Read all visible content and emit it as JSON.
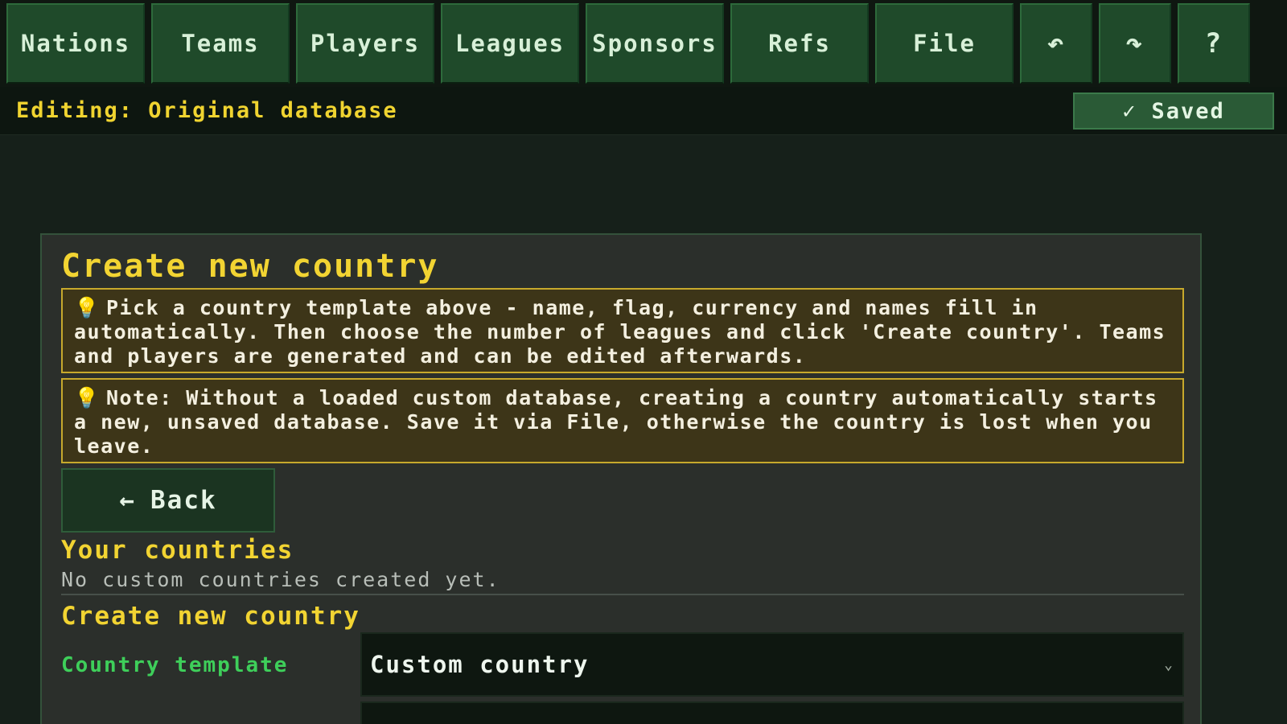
{
  "nav": {
    "items": [
      {
        "label": "Nations"
      },
      {
        "label": "Teams"
      },
      {
        "label": "Players"
      },
      {
        "label": "Leagues"
      },
      {
        "label": "Sponsors"
      },
      {
        "label": "Refs"
      },
      {
        "label": "File"
      },
      {
        "label": "↶"
      },
      {
        "label": "↷"
      },
      {
        "label": "?"
      }
    ]
  },
  "status": {
    "editing": "Editing: Original database",
    "saved_check": "✓",
    "saved_label": "Saved"
  },
  "panel": {
    "title": "Create new country",
    "tip_icon": "💡",
    "tip1": "Pick a country template above - name, flag, currency and names fill in automatically. Then choose the number of leagues and click 'Create country'. Teams and players are generated and can be edited afterwards.",
    "tip2": "Note: Without a loaded custom database, creating a country automatically starts a new, unsaved database. Save it via File, otherwise the country is lost when you leave.",
    "back_arrow": "←",
    "back_label": "Back",
    "your_countries_title": "Your countries",
    "empty_message": "No custom countries created yet.",
    "create_title": "Create new country",
    "template_label": "Country template",
    "template_value": "Custom country",
    "chevron": "⌄"
  },
  "icons": {
    "undo": "undo-icon",
    "redo": "redo-icon",
    "help": "help-icon",
    "bulb": "lightbulb-icon",
    "check": "check-icon",
    "back": "arrow-left-icon",
    "chevron": "chevron-down-icon"
  },
  "colors": {
    "accent_yellow": "#f2d432",
    "nav_green": "#1f4a2a",
    "label_green": "#3ecf5a",
    "tip_border": "#c7a92c"
  }
}
